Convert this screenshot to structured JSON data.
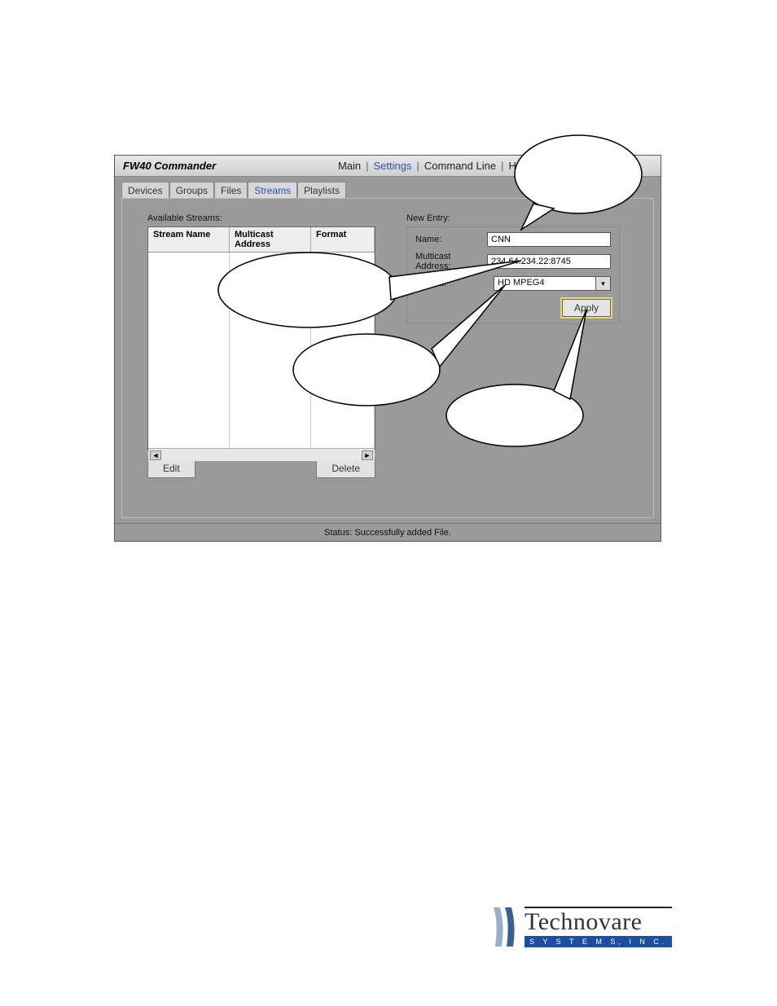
{
  "app": {
    "title": "FW40 Commander"
  },
  "menu": {
    "items": [
      "Main",
      "Settings",
      "Command Line",
      "Help"
    ],
    "active_index": 1
  },
  "tabs": {
    "items": [
      "Devices",
      "Groups",
      "Files",
      "Streams",
      "Playlists"
    ],
    "active_index": 3
  },
  "streams_panel": {
    "label": "Available Streams:",
    "columns": [
      "Stream Name",
      "Multicast Address",
      "Format"
    ],
    "edit_label": "Edit",
    "delete_label": "Delete"
  },
  "new_entry": {
    "label": "New Entry:",
    "name_label": "Name:",
    "name_value": "CNN",
    "addr_label": "Multicast Address:",
    "addr_value": "234.64.234.22:8745",
    "format_label": "Format:",
    "format_value": "HD MPEG4",
    "apply_label": "Apply"
  },
  "status": {
    "label": "Status:",
    "text": "Successfully added File."
  },
  "logo": {
    "main": "Technovare",
    "sub": "S Y S T E M S,  I N C."
  }
}
